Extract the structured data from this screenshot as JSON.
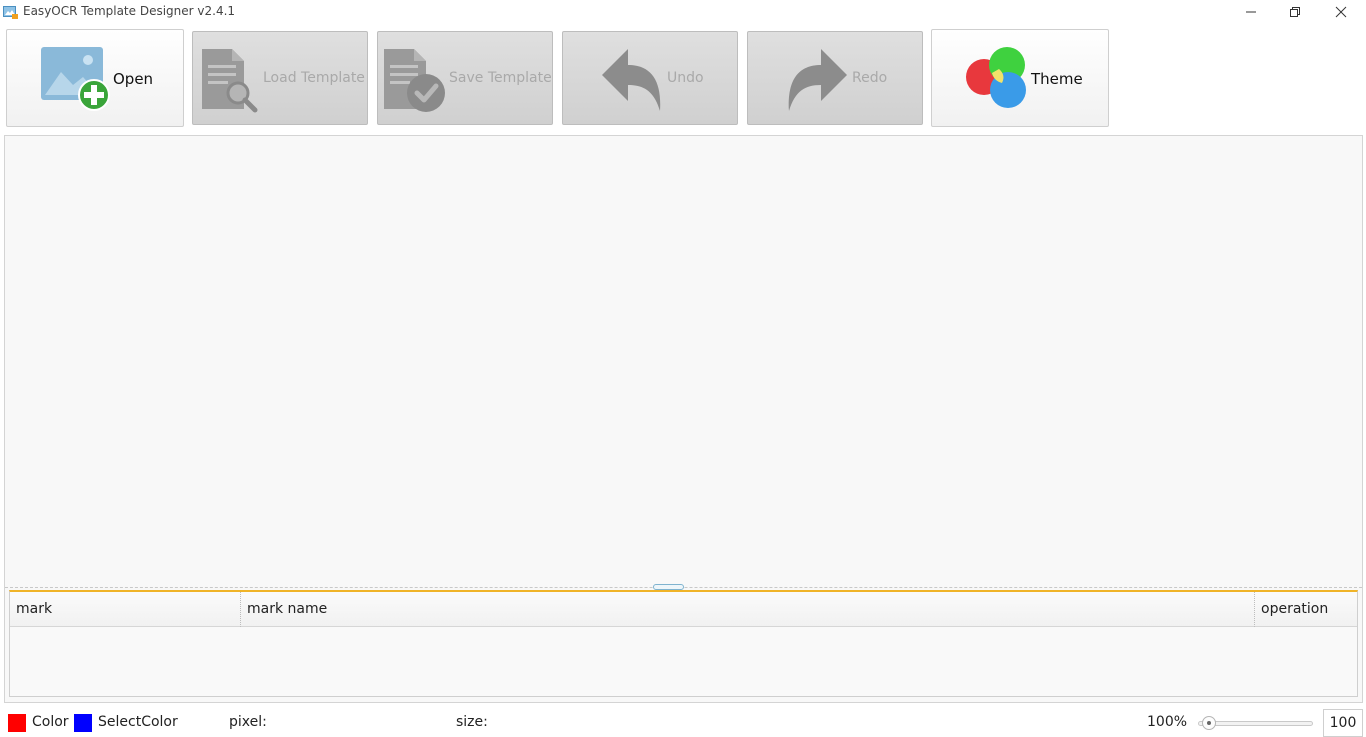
{
  "window": {
    "title": "EasyOCR Template Designer v2.4.1",
    "icons": [
      "app-icon",
      "minimize-icon",
      "restore-icon",
      "close-icon"
    ]
  },
  "toolbar": {
    "open": {
      "label": "Open",
      "icon": "open-image-add-icon",
      "enabled": true
    },
    "load_template": {
      "label": "Load Template",
      "icon": "load-template-icon",
      "enabled": false
    },
    "save_template": {
      "label": "Save Template",
      "icon": "save-template-icon",
      "enabled": false
    },
    "undo": {
      "label": "Undo",
      "icon": "undo-icon",
      "enabled": false
    },
    "redo": {
      "label": "Redo",
      "icon": "redo-icon",
      "enabled": false
    },
    "theme": {
      "label": "Theme",
      "icon": "theme-icon",
      "enabled": true
    }
  },
  "table": {
    "columns": [
      "mark",
      "mark name",
      "operation"
    ],
    "rows": []
  },
  "status": {
    "color_label": "Color",
    "color_value": "#ff0000",
    "select_color_label": "SelectColor",
    "select_color_value": "#0000ff",
    "pixel_label": "pixel:",
    "size_label": "size:",
    "zoom_percent": "100%",
    "zoom_value": "100"
  },
  "colors": {
    "table_accent": "#f0b429",
    "open_icon_plus": "#3aa53a",
    "theme_red": "#e8383d",
    "theme_green": "#3fd13f",
    "theme_blue": "#3a9be8"
  }
}
